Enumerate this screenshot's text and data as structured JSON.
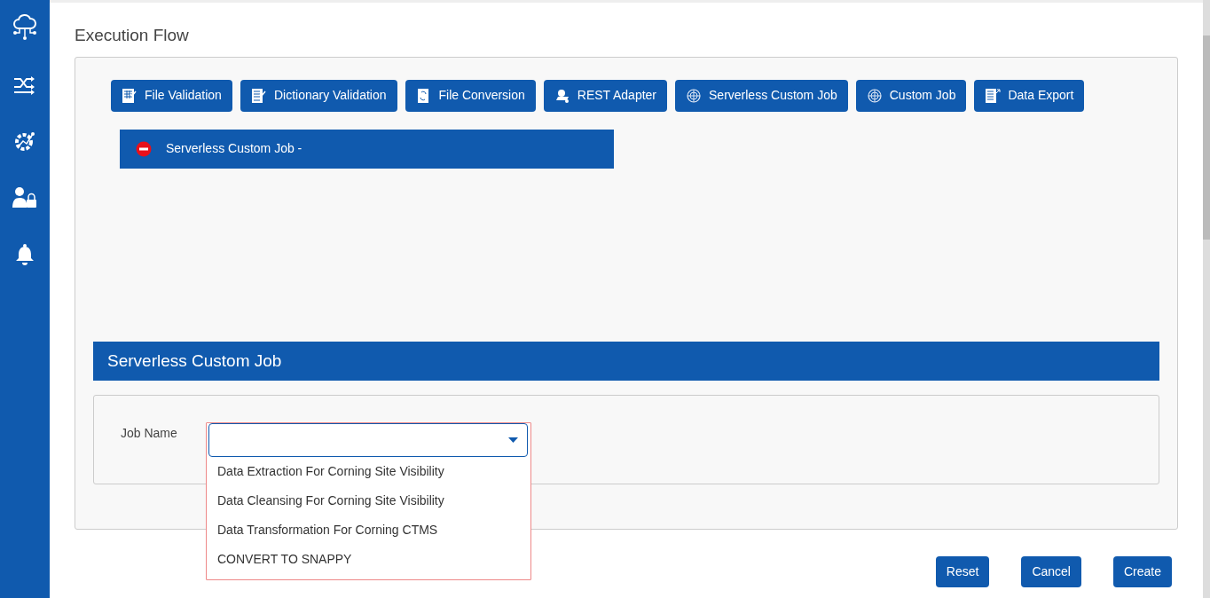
{
  "page_title": "Execution Flow",
  "palette": [
    "File Validation",
    "Dictionary Validation",
    "File Conversion",
    "REST Adapter",
    "Serverless Custom Job",
    "Custom Job",
    "Data Export"
  ],
  "flow_node": {
    "label": "Serverless Custom Job -"
  },
  "section": {
    "title": "Serverless Custom Job",
    "job_name": {
      "label": "Job Name",
      "expanded": true,
      "options": [
        {
          "label": "Data Extraction For Corning Site Visibility",
          "selected": false
        },
        {
          "label": "Data Cleansing For Corning Site Visibility",
          "selected": false
        },
        {
          "label": "Data Transformation For Corning CTMS",
          "selected": false
        },
        {
          "label": "CONVERT TO SNAPPY",
          "selected": false
        }
      ]
    }
  },
  "buttons": [
    "Reset",
    "Cancel",
    "Create"
  ]
}
